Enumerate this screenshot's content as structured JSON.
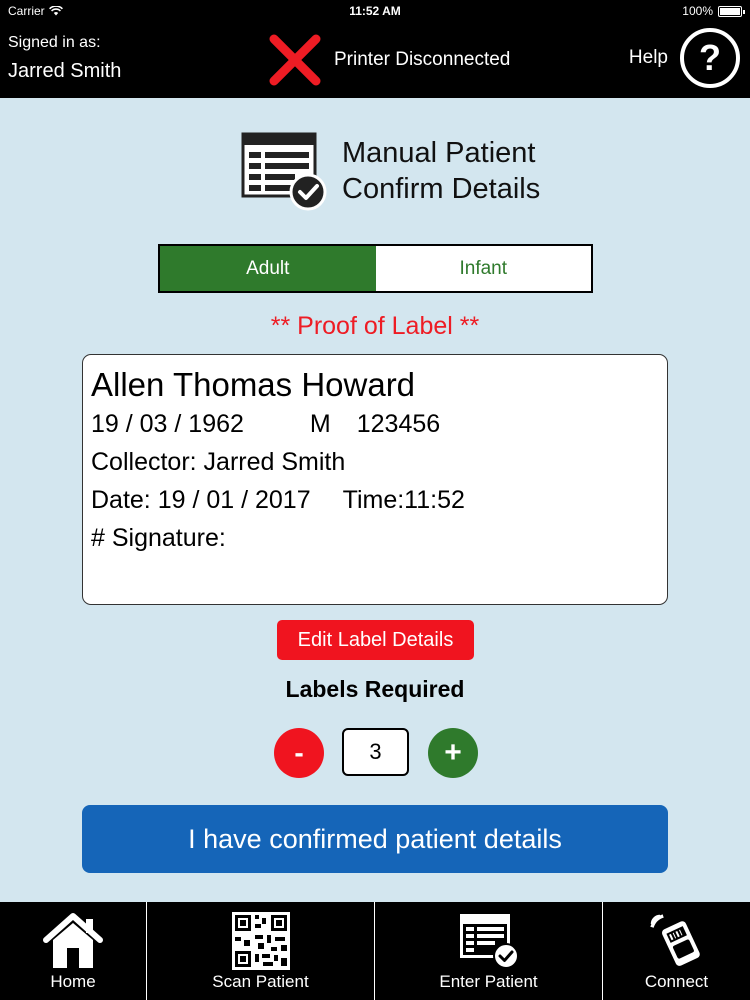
{
  "status_bar": {
    "carrier": "Carrier",
    "time": "11:52 AM",
    "battery": "100%"
  },
  "header": {
    "signed_in_label": "Signed in as:",
    "user_name": "Jarred Smith",
    "printer_status": "Printer Disconnected",
    "help_label": "Help",
    "help_glyph": "?"
  },
  "page": {
    "title_line1": "Manual Patient",
    "title_line2": "Confirm Details"
  },
  "patient_type": {
    "options": [
      "Adult",
      "Infant"
    ],
    "selected": "Adult"
  },
  "proof_label": "** Proof of Label **",
  "label": {
    "name": "Allen Thomas Howard",
    "dob": "19 / 03 / 1962",
    "sex": "M",
    "id": "123456",
    "collector": "Collector: Jarred Smith",
    "date": "Date: 19 / 01 / 2017",
    "time": "Time:11:52",
    "signature": "# Signature:"
  },
  "edit_button": "Edit Label Details",
  "labels_required": {
    "title": "Labels Required",
    "value": "3",
    "minus": "-",
    "plus": "+"
  },
  "confirm_button": "I have confirmed patient details",
  "tabs": [
    {
      "label": "Home",
      "icon": "home-icon"
    },
    {
      "label": "Scan Patient",
      "icon": "qr-code-icon"
    },
    {
      "label": "Enter Patient",
      "icon": "form-check-icon"
    },
    {
      "label": "Connect",
      "icon": "printer-connect-icon"
    }
  ],
  "colors": {
    "green": "#2f7a2c",
    "red": "#f0141f",
    "blue": "#1565b8",
    "background": "#d3e6ef"
  }
}
